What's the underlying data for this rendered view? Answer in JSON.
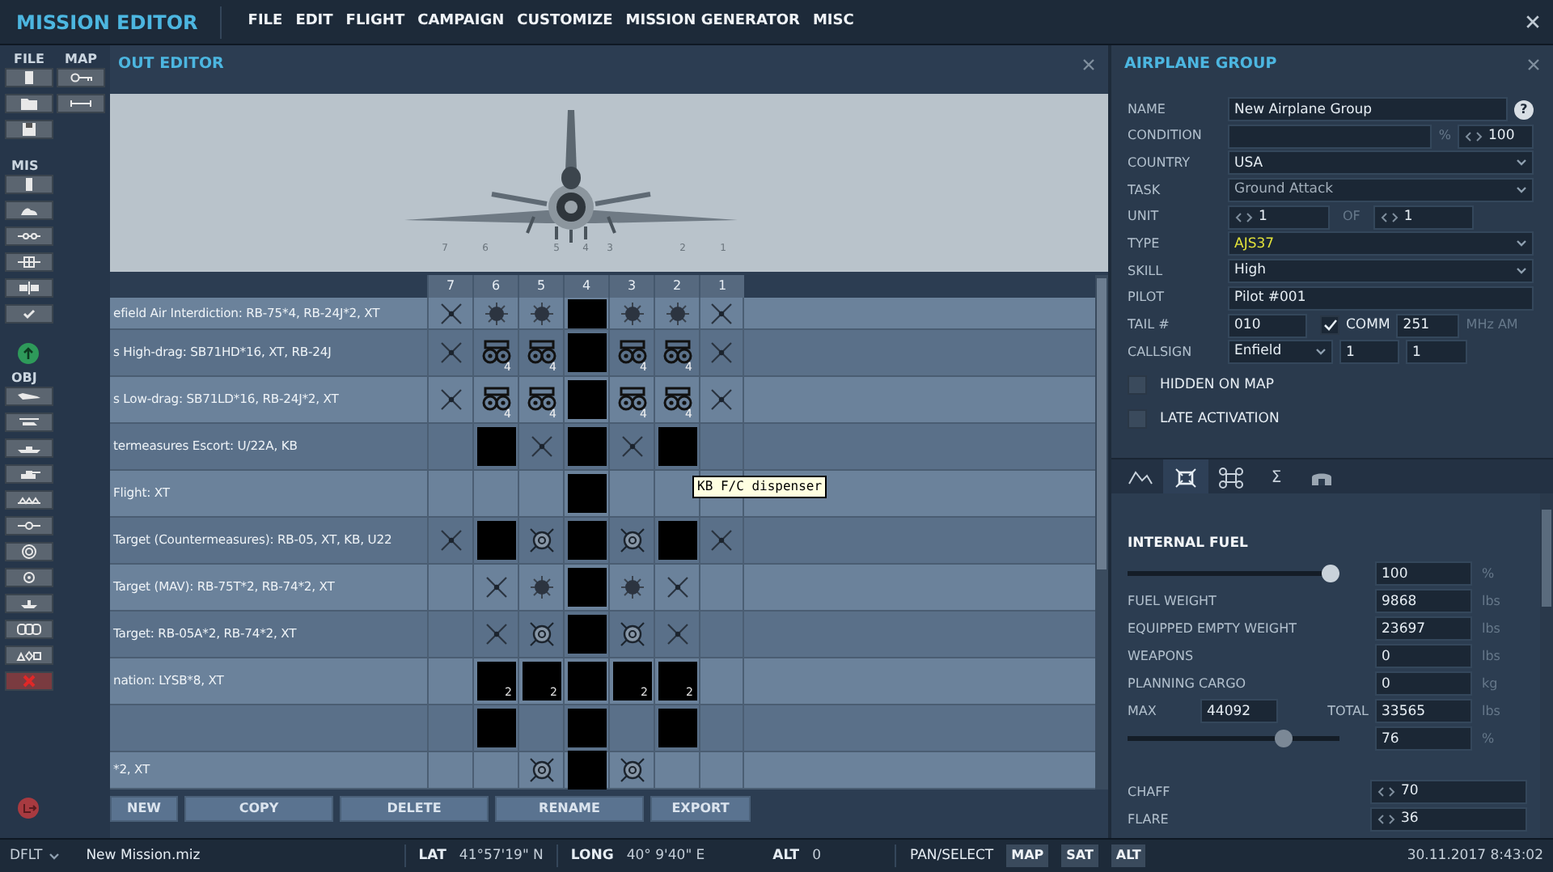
{
  "app": {
    "title": "MISSION EDITOR",
    "menu": [
      "FILE",
      "EDIT",
      "FLIGHT",
      "CAMPAIGN",
      "CUSTOMIZE",
      "MISSION GENERATOR",
      "MISC"
    ]
  },
  "toolbar": {
    "file": "FILE",
    "map": "MAP",
    "mis": "MIS",
    "obj": "OBJ"
  },
  "loadout": {
    "title": "OUT EDITOR",
    "pylon_labels": [
      "7",
      "6",
      "5",
      "4",
      "3",
      "2",
      "1"
    ],
    "stations": [
      "7",
      "6",
      "5",
      "4",
      "3",
      "2",
      "1"
    ],
    "rows": [
      {
        "name": "efield Air Interdiction: RB-75*4, RB-24J*2, XT",
        "cells": [
          {
            "kind": "cross"
          },
          {
            "kind": "mine"
          },
          {
            "kind": "mine"
          },
          {
            "kind": "block"
          },
          {
            "kind": "mine"
          },
          {
            "kind": "mine"
          },
          {
            "kind": "cross"
          }
        ]
      },
      {
        "name": "s High-drag: SB71HD*16, XT, RB-24J",
        "cells": [
          {
            "kind": "cross"
          },
          {
            "kind": "rack",
            "count": "4"
          },
          {
            "kind": "rack",
            "count": "4"
          },
          {
            "kind": "block"
          },
          {
            "kind": "rack",
            "count": "4"
          },
          {
            "kind": "rack",
            "count": "4"
          },
          {
            "kind": "cross"
          }
        ]
      },
      {
        "name": "s Low-drag: SB71LD*16, RB-24J*2, XT",
        "cells": [
          {
            "kind": "cross"
          },
          {
            "kind": "rack",
            "count": "4"
          },
          {
            "kind": "rack",
            "count": "4"
          },
          {
            "kind": "block"
          },
          {
            "kind": "rack",
            "count": "4"
          },
          {
            "kind": "rack",
            "count": "4"
          },
          {
            "kind": "cross"
          }
        ]
      },
      {
        "name": "termeasures Escort: U/22A, KB",
        "cells": [
          {
            "kind": "empty"
          },
          {
            "kind": "block"
          },
          {
            "kind": "cross"
          },
          {
            "kind": "block"
          },
          {
            "kind": "cross"
          },
          {
            "kind": "block"
          },
          {
            "kind": "empty"
          }
        ]
      },
      {
        "name": "Flight: XT",
        "cells": [
          {
            "kind": "empty"
          },
          {
            "kind": "empty"
          },
          {
            "kind": "empty"
          },
          {
            "kind": "block"
          },
          {
            "kind": "empty"
          },
          {
            "kind": "empty"
          },
          {
            "kind": "empty"
          }
        ]
      },
      {
        "name": "Target (Countermeasures): RB-05, XT, KB, U22",
        "cells": [
          {
            "kind": "cross"
          },
          {
            "kind": "block"
          },
          {
            "kind": "target"
          },
          {
            "kind": "block"
          },
          {
            "kind": "target"
          },
          {
            "kind": "block"
          },
          {
            "kind": "cross"
          }
        ]
      },
      {
        "name": "Target (MAV): RB-75T*2, RB-74*2, XT",
        "cells": [
          {
            "kind": "empty"
          },
          {
            "kind": "cross"
          },
          {
            "kind": "mine"
          },
          {
            "kind": "block"
          },
          {
            "kind": "mine"
          },
          {
            "kind": "cross"
          },
          {
            "kind": "empty"
          }
        ]
      },
      {
        "name": "Target: RB-05A*2, RB-74*2, XT",
        "cells": [
          {
            "kind": "empty"
          },
          {
            "kind": "cross"
          },
          {
            "kind": "target"
          },
          {
            "kind": "block"
          },
          {
            "kind": "target"
          },
          {
            "kind": "cross"
          },
          {
            "kind": "empty"
          }
        ]
      },
      {
        "name": "nation: LYSB*8, XT",
        "cells": [
          {
            "kind": "empty"
          },
          {
            "kind": "block",
            "count": "2"
          },
          {
            "kind": "block",
            "count": "2"
          },
          {
            "kind": "block"
          },
          {
            "kind": "block",
            "count": "2"
          },
          {
            "kind": "block",
            "count": "2"
          },
          {
            "kind": "empty"
          }
        ]
      },
      {
        "cells": [
          {
            "kind": "empty"
          },
          {
            "kind": "block"
          },
          {
            "kind": "empty"
          },
          {
            "kind": "block"
          },
          {
            "kind": "empty"
          },
          {
            "kind": "block"
          },
          {
            "kind": "empty"
          }
        ]
      },
      {
        "name": "*2, XT",
        "cells": [
          {
            "kind": "empty"
          },
          {
            "kind": "empty"
          },
          {
            "kind": "target"
          },
          {
            "kind": "block"
          },
          {
            "kind": "target"
          },
          {
            "kind": "empty"
          },
          {
            "kind": "empty"
          }
        ]
      }
    ],
    "tooltip": "KB F/C dispenser",
    "buttons": [
      "NEW",
      "COPY",
      "DELETE",
      "RENAME",
      "EXPORT"
    ]
  },
  "group": {
    "title": "AIRPLANE GROUP",
    "name": {
      "label": "NAME",
      "value": "New Airplane Group",
      "help": "?"
    },
    "condition": {
      "label": "CONDITION",
      "unit": "%",
      "value": "100"
    },
    "country": {
      "label": "COUNTRY",
      "value": "USA"
    },
    "task": {
      "label": "TASK",
      "value": "Ground Attack",
      "disabled": true
    },
    "unit": {
      "label": "UNIT",
      "value": "1",
      "of_label": "OF",
      "of_value": "1"
    },
    "type": {
      "label": "TYPE",
      "value": "AJS37"
    },
    "skill": {
      "label": "SKILL",
      "value": "High"
    },
    "pilot": {
      "label": "PILOT",
      "value": "Pilot #001"
    },
    "tail": {
      "label": "TAIL #",
      "value": "010"
    },
    "comm": {
      "label": "COMM",
      "checked": true,
      "value": "251",
      "unit": "MHz AM"
    },
    "callsign": {
      "label": "CALLSIGN",
      "value": "Enfield",
      "number_1": "1",
      "number_2": "1"
    },
    "options": [
      {
        "label": "HIDDEN ON MAP",
        "checked": false
      },
      {
        "label": "LATE ACTIVATION",
        "checked": false
      }
    ]
  },
  "tabs": [
    {
      "kind": "route",
      "selected": false
    },
    {
      "kind": "payload",
      "selected": true
    },
    {
      "kind": "drone",
      "selected": false
    },
    {
      "kind": "summary",
      "label": "Σ",
      "selected": false
    },
    {
      "kind": "hangar",
      "selected": false
    }
  ],
  "fuel": {
    "title": "INTERNAL FUEL",
    "internal": {
      "level": 1,
      "value": "100",
      "unit": "%"
    },
    "rows": [
      {
        "label": "FUEL WEIGHT",
        "value": "9868",
        "unit": "lbs"
      },
      {
        "label": "EQUIPPED EMPTY WEIGHT",
        "value": "23697",
        "unit": "lbs"
      },
      {
        "label": "WEAPONS",
        "value": "0",
        "unit": "lbs"
      },
      {
        "label": "PLANNING CARGO",
        "value": "0",
        "unit": "kg"
      }
    ],
    "max": {
      "label": "MAX",
      "value": "44092",
      "total_label": "TOTAL",
      "total": "33565",
      "unit": "lbs"
    },
    "load": {
      "level": 0.76,
      "value": "76",
      "unit": "%"
    },
    "countermeasures": [
      {
        "label": "CHAFF",
        "value": "70"
      },
      {
        "label": "FLARE",
        "value": "36"
      }
    ]
  },
  "status": {
    "profile": "DFLT",
    "file": "New Mission.miz",
    "lat_label": "LAT",
    "lat": "41°57'19\" N",
    "long_label": "LONG",
    "long": "40° 9'40\" E",
    "alt_label": "ALT",
    "alt": "0",
    "mode": "PAN/SELECT",
    "map_buttons": [
      "MAP",
      "SAT",
      "ALT"
    ],
    "datetime": "30.11.2017 8:43:02"
  }
}
